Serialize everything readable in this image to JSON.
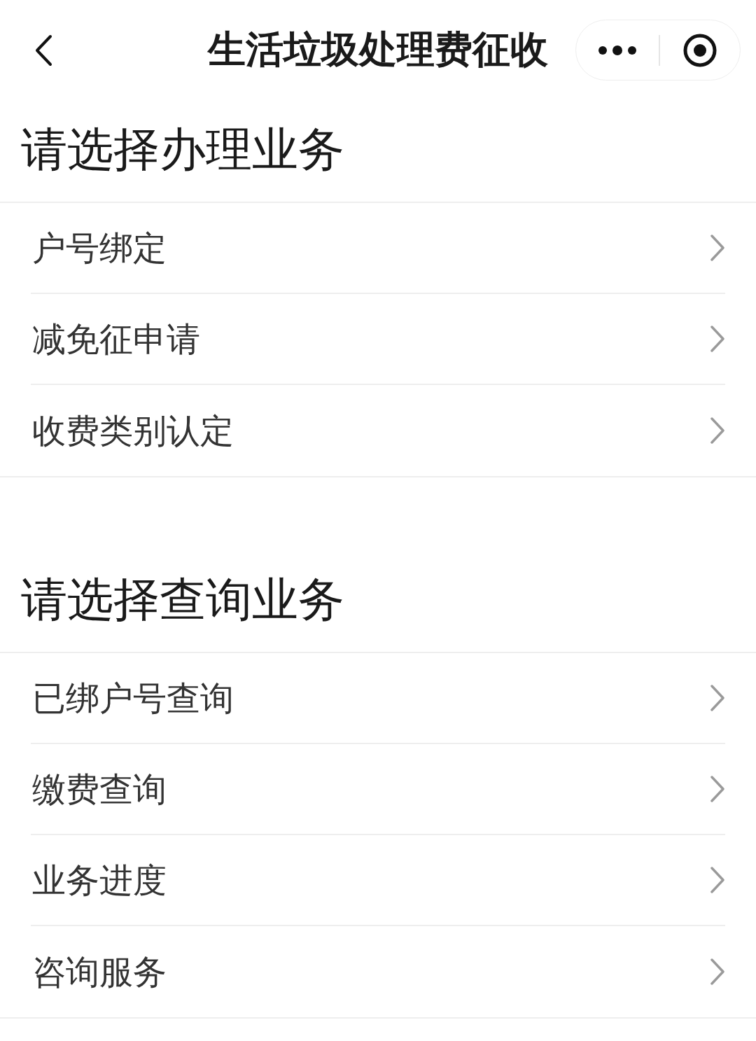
{
  "nav_bar": {
    "title": "生活垃圾处理费征收"
  },
  "sections": [
    {
      "title": "请选择办理业务",
      "items": [
        "户号绑定",
        "减免征申请",
        "收费类别认定"
      ]
    },
    {
      "title": "请选择查询业务",
      "items": [
        "已绑户号查询",
        "缴费查询",
        "业务进度",
        "咨询服务"
      ]
    }
  ]
}
